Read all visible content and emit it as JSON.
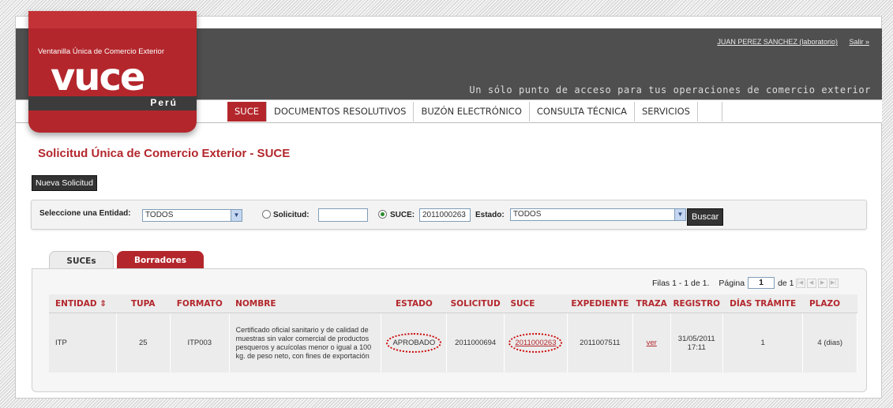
{
  "header": {
    "user_link": "JUAN PEREZ SANCHEZ (laboratorio)",
    "logout_link": "Salir »",
    "tagline": "Un sólo punto de acceso para tus operaciones de comercio exterior"
  },
  "logo": {
    "subtitle": "Ventanilla Única de Comercio Exterior",
    "word": "vuce",
    "country": "Perú"
  },
  "nav": {
    "items": [
      "SUCE",
      "DOCUMENTOS RESOLUTIVOS",
      "BUZÓN ELECTRÓNICO",
      "CONSULTA TÉCNICA",
      "SERVICIOS"
    ],
    "active": "SUCE"
  },
  "page_title": "Solicitud Única de Comercio Exterior - SUCE",
  "new_button": "Nueva Solicitud",
  "filter": {
    "entity_label": "Seleccione una Entidad:",
    "entity_value": "TODOS",
    "solicitud_label": "Solicitud:",
    "solicitud_value": "",
    "suce_label": "SUCE:",
    "suce_value": "2011000263",
    "estado_label": "Estado:",
    "estado_value": "TODOS",
    "selected_radio": "suce",
    "search_button": "Buscar"
  },
  "tabs": [
    "SUCEs",
    "Borradores"
  ],
  "pager": {
    "rows_text": "Filas 1 - 1 de 1.",
    "page_label": "Página",
    "page_value": "1",
    "of_text": "de 1"
  },
  "table": {
    "columns": [
      "ENTIDAD ⇕",
      "TUPA",
      "FORMATO",
      "NOMBRE",
      "ESTADO",
      "SOLICITUD",
      "SUCE",
      "EXPEDIENTE",
      "TRAZA",
      "REGISTRO",
      "DÍAS TRÁMITE",
      "PLAZO"
    ],
    "rows": [
      {
        "entidad": "ITP",
        "tupa": "25",
        "formato": "ITP003",
        "nombre": "Certificado oficial sanitario y de calidad de muestras sin valor comercial de productos pesqueros y acuícolas menor o igual a 100 kg. de peso neto, con fines de exportación",
        "estado": "APROBADO",
        "solicitud": "2011000694",
        "suce": "2011000263",
        "expediente": "2011007511",
        "traza": "ver",
        "registro_fecha": "31/05/2011",
        "registro_hora": "17:11",
        "dias": "1",
        "plazo": "4 (dias)"
      }
    ]
  },
  "colors": {
    "brand_red": "#b3272c",
    "header_gray": "#4f4f4f",
    "annotation_red": "#c00000"
  }
}
